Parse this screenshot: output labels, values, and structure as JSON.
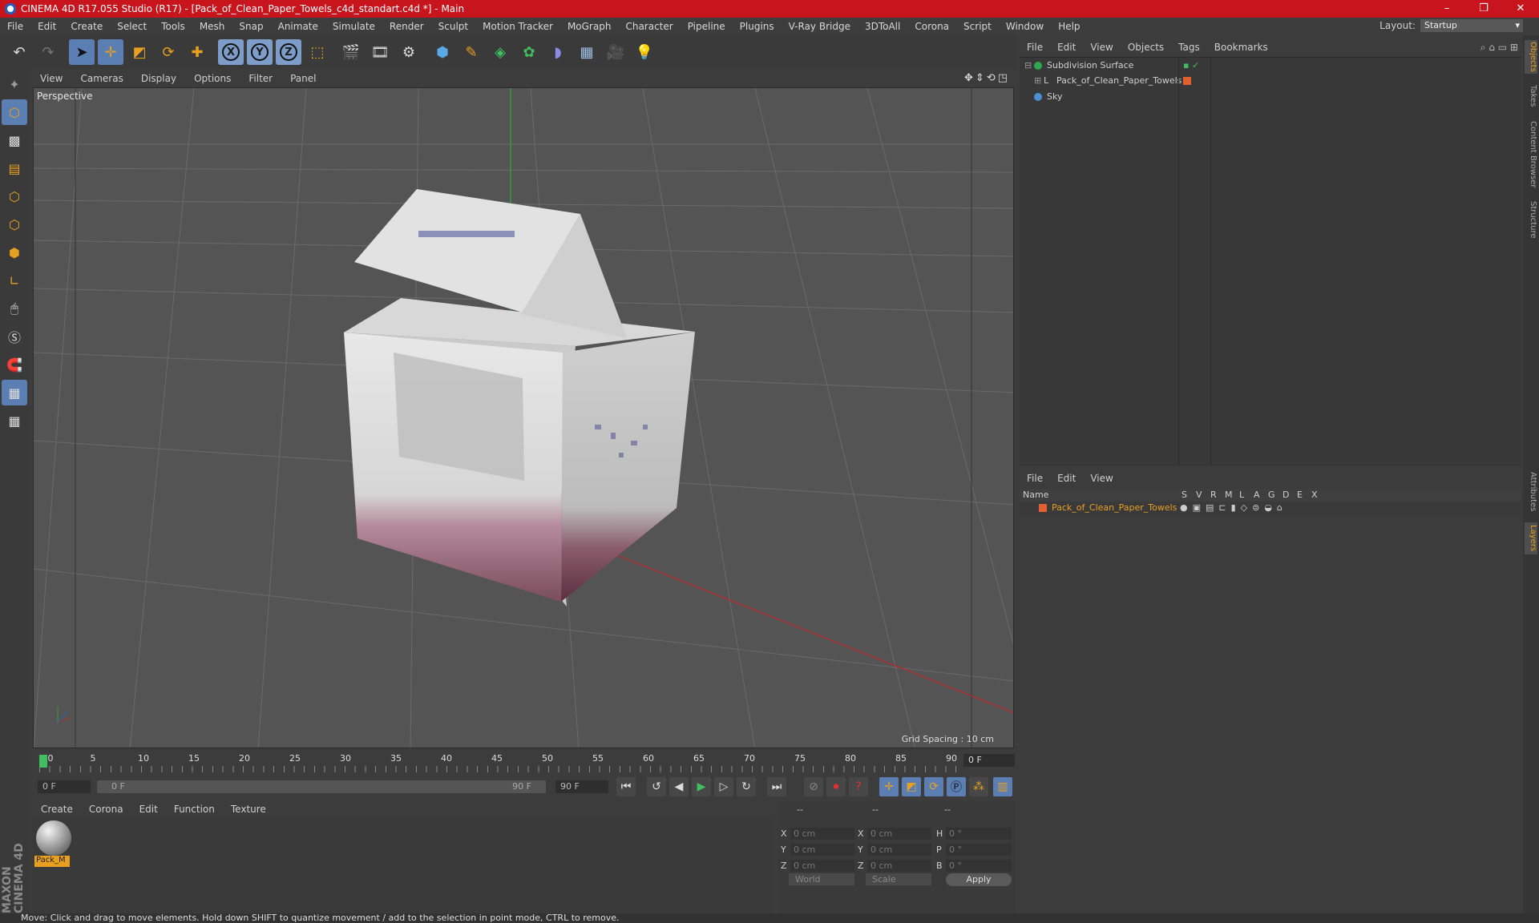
{
  "window": {
    "title": "CINEMA 4D R17.055 Studio (R17) - [Pack_of_Clean_Paper_Towels_c4d_standart.c4d *] - Main",
    "controls": [
      "–",
      "❐",
      "✕"
    ]
  },
  "menu": [
    "File",
    "Edit",
    "Create",
    "Select",
    "Tools",
    "Mesh",
    "Snap",
    "Animate",
    "Simulate",
    "Render",
    "Sculpt",
    "Motion Tracker",
    "MoGraph",
    "Character",
    "Pipeline",
    "Plugins",
    "V-Ray Bridge",
    "3DToAll",
    "Corona",
    "Script",
    "Window",
    "Help"
  ],
  "layout": {
    "label": "Layout:",
    "value": "Startup"
  },
  "toolbar": {
    "x_label": "X",
    "y_label": "Y",
    "z_label": "Z"
  },
  "viewport": {
    "menu": [
      "View",
      "Cameras",
      "Display",
      "Options",
      "Filter",
      "Panel"
    ],
    "camera_label": "Perspective",
    "grid_spacing": "Grid Spacing : 10 cm"
  },
  "timeline": {
    "ticks": [
      "0",
      "5",
      "10",
      "15",
      "20",
      "25",
      "30",
      "35",
      "40",
      "45",
      "50",
      "55",
      "60",
      "65",
      "70",
      "75",
      "80",
      "85",
      "90"
    ],
    "current_frame": "0 F",
    "start_field": "0 F",
    "range_start": "0 F",
    "range_end": "90 F",
    "end_field": "90 F"
  },
  "materials": {
    "menu": [
      "Create",
      "Corona",
      "Edit",
      "Function",
      "Texture"
    ],
    "items": [
      {
        "label": "Pack_M"
      }
    ]
  },
  "coordinates": {
    "headers": [
      "--",
      "--",
      "--"
    ],
    "rows": [
      {
        "a": "X",
        "av": "0 cm",
        "b": "X",
        "bv": "0 cm",
        "c": "H",
        "cv": "0 °"
      },
      {
        "a": "Y",
        "av": "0 cm",
        "b": "Y",
        "bv": "0 cm",
        "c": "P",
        "cv": "0 °"
      },
      {
        "a": "Z",
        "av": "0 cm",
        "b": "Z",
        "bv": "0 cm",
        "c": "B",
        "cv": "0 °"
      }
    ],
    "mode": "World",
    "scale": "Scale",
    "apply": "Apply"
  },
  "objects": {
    "menu": [
      "File",
      "Edit",
      "View",
      "Objects",
      "Tags",
      "Bookmarks"
    ],
    "items": [
      {
        "name": "Subdivision Surface",
        "color": "#2fa84f"
      },
      {
        "name": "Pack_of_Clean_Paper_Towels",
        "color": "#cfcfcf"
      },
      {
        "name": "Sky",
        "color": "#4a8fd0"
      }
    ]
  },
  "layers": {
    "menu": [
      "File",
      "Edit",
      "View"
    ],
    "header": {
      "name": "Name",
      "cols": [
        "S",
        "V",
        "R",
        "M",
        "L",
        "A",
        "G",
        "D",
        "E",
        "X"
      ]
    },
    "items": [
      {
        "name": "Pack_of_Clean_Paper_Towels",
        "color": "#e8a020"
      }
    ]
  },
  "side_tabs": [
    "Objects",
    "Takes",
    "Content Browser",
    "Structure",
    "Attributes",
    "Layers"
  ],
  "brand": "MAXON CINEMA 4D",
  "status": "Move: Click and drag to move elements. Hold down SHIFT to quantize movement / add to the selection in point mode, CTRL to remove.",
  "colors": {
    "accent": "#e8a020",
    "title_bar": "#c8141c",
    "active_tool": "#5b7fb3"
  }
}
